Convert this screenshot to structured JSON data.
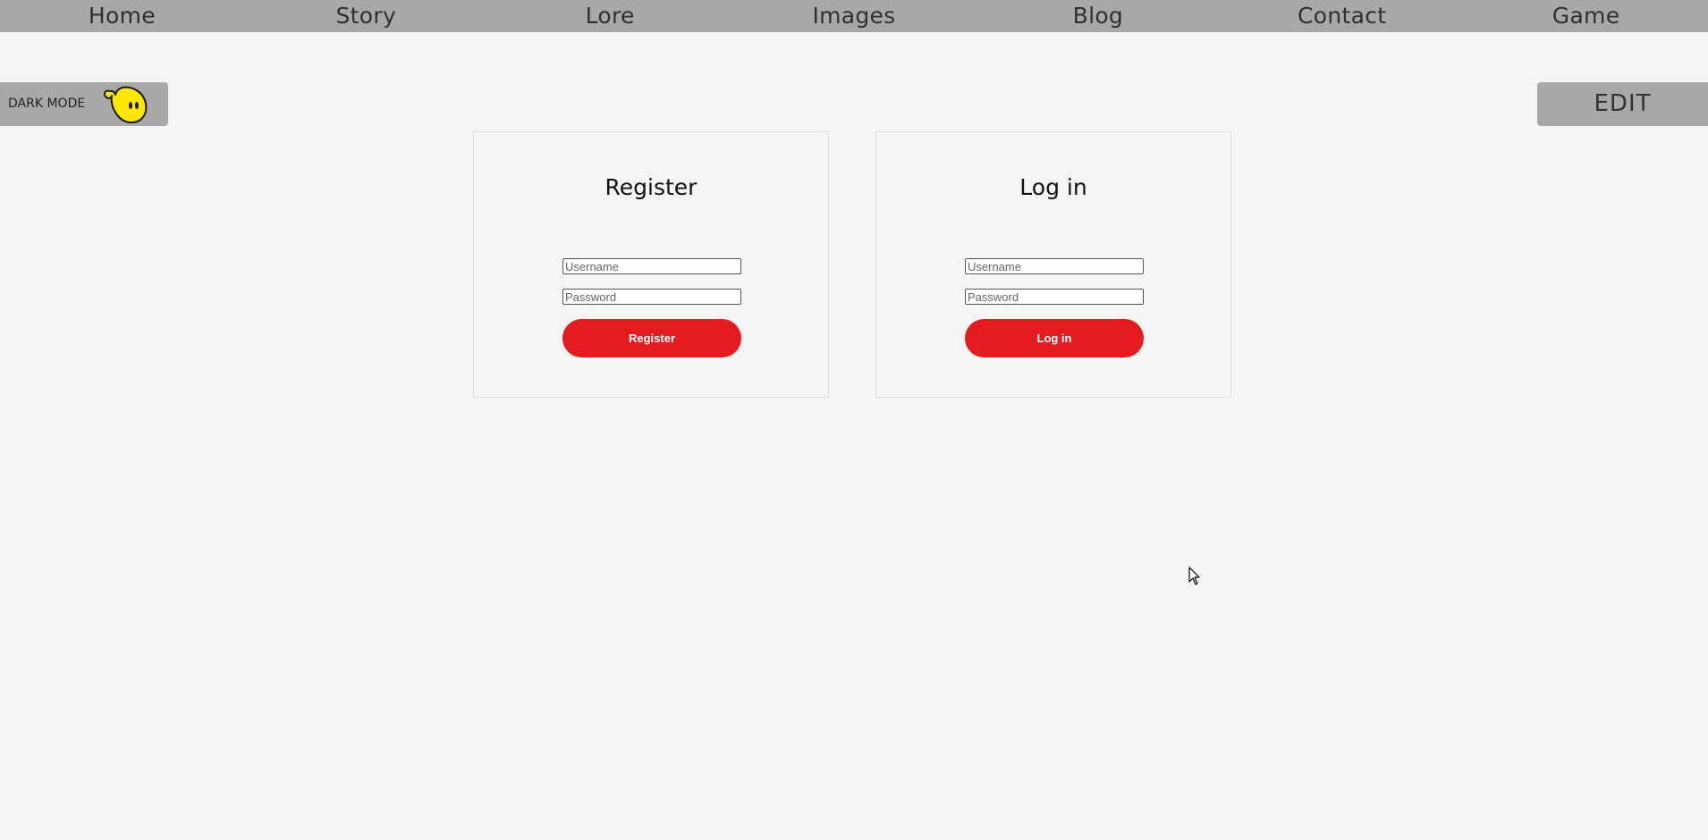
{
  "nav": {
    "items": [
      {
        "label": "Home"
      },
      {
        "label": "Story"
      },
      {
        "label": "Lore"
      },
      {
        "label": "Images"
      },
      {
        "label": "Blog"
      },
      {
        "label": "Contact"
      },
      {
        "label": "Game"
      }
    ]
  },
  "dark_mode": {
    "label": "DARK MODE",
    "icon": "moon-icon"
  },
  "edit": {
    "label": "EDIT"
  },
  "register": {
    "title": "Register",
    "username_placeholder": "Username",
    "password_placeholder": "Password",
    "button_label": "Register"
  },
  "login": {
    "title": "Log in",
    "username_placeholder": "Username",
    "password_placeholder": "Password",
    "button_label": "Log in"
  },
  "colors": {
    "nav_bg": "#a8a8a8",
    "page_bg": "#f5f5f3",
    "button_red": "#e51c1f",
    "moon_yellow": "#ffe600"
  }
}
